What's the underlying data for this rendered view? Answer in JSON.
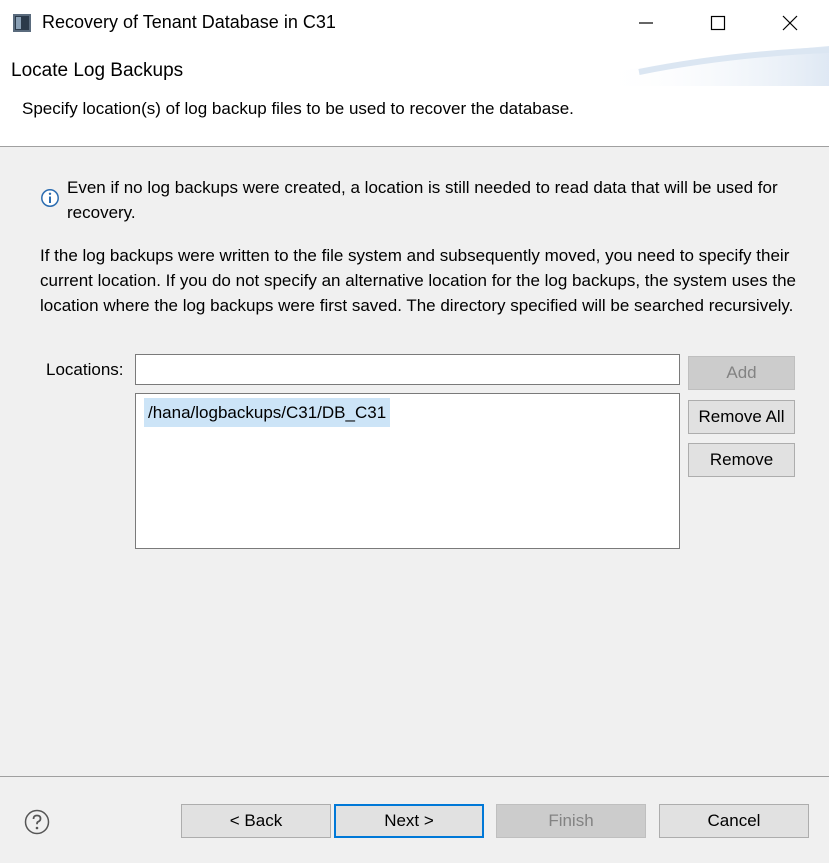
{
  "window": {
    "title": "Recovery of Tenant Database in C31",
    "controls": [
      "minimize-icon",
      "maximize-icon",
      "close-icon"
    ]
  },
  "header": {
    "title": "Locate Log Backups",
    "description": "Specify location(s) of log backup files to be used to recover the database."
  },
  "info": {
    "icon": "info-icon",
    "text": "Even if no log backups were created, a location is still needed to read data that will be used for recovery."
  },
  "paragraph": "If the log backups were written to the file system and subsequently moved, you need to specify their current location. If you do not specify an alternative location for the log backups, the system uses the location where the log backups were first saved. The directory specified will be searched recursively.",
  "locations": {
    "label": "Locations:",
    "input_value": "",
    "items": [
      "/hana/logbackups/C31/DB_C31"
    ]
  },
  "side_buttons": {
    "add": "Add",
    "remove_all": "Remove All",
    "remove": "Remove"
  },
  "footer": {
    "help_icon": "help-icon",
    "back": "< Back",
    "next": "Next >",
    "finish": "Finish",
    "cancel": "Cancel"
  },
  "colors": {
    "accent": "#0078d7",
    "selection": "#cce4f7",
    "dialog_bg": "#f0f0f0"
  }
}
